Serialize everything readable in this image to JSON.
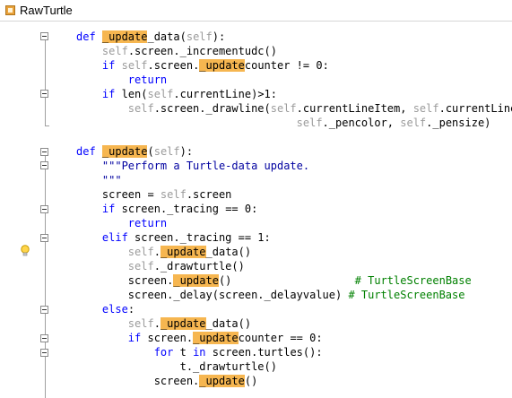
{
  "header": {
    "class_name": "RawTurtle"
  },
  "code_lines": [
    [
      [
        "kw",
        "def "
      ],
      [
        "hl",
        "_update"
      ],
      [
        "",
        "_data("
      ],
      [
        "sf",
        "self"
      ],
      [
        "",
        "):"
      ]
    ],
    [
      [
        "",
        "    "
      ],
      [
        "sf",
        "self"
      ],
      [
        "",
        ".screen._incrementudc()"
      ]
    ],
    [
      [
        "",
        "    "
      ],
      [
        "kw",
        "if "
      ],
      [
        "sf",
        "self"
      ],
      [
        "",
        ".screen."
      ],
      [
        "hl",
        "_update"
      ],
      [
        "",
        "counter != 0:"
      ]
    ],
    [
      [
        "",
        "        "
      ],
      [
        "kw",
        "return"
      ]
    ],
    [
      [
        "",
        "    "
      ],
      [
        "kw",
        "if "
      ],
      [
        "",
        "len("
      ],
      [
        "sf",
        "self"
      ],
      [
        "",
        ".currentLine)>1:"
      ]
    ],
    [
      [
        "",
        "        "
      ],
      [
        "sf",
        "self"
      ],
      [
        "",
        ".screen._drawline("
      ],
      [
        "sf",
        "self"
      ],
      [
        "",
        ".currentLineItem, "
      ],
      [
        "sf",
        "self"
      ],
      [
        "",
        ".currentLine,"
      ]
    ],
    [
      [
        "",
        "                                  "
      ],
      [
        "sf",
        "self"
      ],
      [
        "",
        "._pencolor, "
      ],
      [
        "sf",
        "self"
      ],
      [
        "",
        "._pensize)"
      ]
    ],
    [],
    [
      [
        "kw",
        "def "
      ],
      [
        "hl",
        "_update"
      ],
      [
        "",
        "("
      ],
      [
        "sf",
        "self"
      ],
      [
        "",
        "):"
      ]
    ],
    [
      [
        "",
        "    "
      ],
      [
        "st",
        "\"\"\"Perform a Turtle-data update."
      ]
    ],
    [
      [
        "",
        "    "
      ],
      [
        "st",
        "\"\"\""
      ]
    ],
    [
      [
        "",
        "    screen = "
      ],
      [
        "sf",
        "self"
      ],
      [
        "",
        ".screen"
      ]
    ],
    [
      [
        "",
        "    "
      ],
      [
        "kw",
        "if "
      ],
      [
        "",
        "screen._tracing == 0:"
      ]
    ],
    [
      [
        "",
        "        "
      ],
      [
        "kw",
        "return"
      ]
    ],
    [
      [
        "",
        "    "
      ],
      [
        "kw",
        "elif "
      ],
      [
        "",
        "screen._tracing == 1:"
      ]
    ],
    [
      [
        "",
        "        "
      ],
      [
        "sf",
        "self"
      ],
      [
        "",
        "."
      ],
      [
        "hl",
        "_update"
      ],
      [
        "",
        "_data()"
      ]
    ],
    [
      [
        "",
        "        "
      ],
      [
        "sf",
        "self"
      ],
      [
        "",
        "._drawturtle()"
      ]
    ],
    [
      [
        "",
        "        screen."
      ],
      [
        "hl",
        "_update"
      ],
      [
        "",
        "()                   "
      ],
      [
        "cm",
        "# TurtleScreenBase"
      ]
    ],
    [
      [
        "",
        "        screen._delay(screen._delayvalue) "
      ],
      [
        "cm",
        "# TurtleScreenBase"
      ]
    ],
    [
      [
        "",
        "    "
      ],
      [
        "kw",
        "else"
      ],
      [
        "",
        ":"
      ]
    ],
    [
      [
        "",
        "        "
      ],
      [
        "sf",
        "self"
      ],
      [
        "",
        "."
      ],
      [
        "hl",
        "_update"
      ],
      [
        "",
        "_data()"
      ]
    ],
    [
      [
        "",
        "        "
      ],
      [
        "kw",
        "if "
      ],
      [
        "",
        "screen."
      ],
      [
        "hl",
        "_update"
      ],
      [
        "",
        "counter == 0:"
      ]
    ],
    [
      [
        "",
        "            "
      ],
      [
        "kw",
        "for "
      ],
      [
        "",
        "t "
      ],
      [
        "kw",
        "in "
      ],
      [
        "",
        "screen.turtles():"
      ]
    ],
    [
      [
        "",
        "                t._drawturtle()"
      ]
    ],
    [
      [
        "",
        "            screen."
      ],
      [
        "hl",
        "_update"
      ],
      [
        "",
        "()"
      ]
    ]
  ],
  "colors": {
    "keyword": "#0000ff",
    "self": "#9b9b9b",
    "highlight": "#f6b650",
    "comment": "#008000",
    "docstring": "#0000a0"
  },
  "icons": [
    "class-icon",
    "fold-collapse-icon",
    "lightbulb-icon"
  ]
}
